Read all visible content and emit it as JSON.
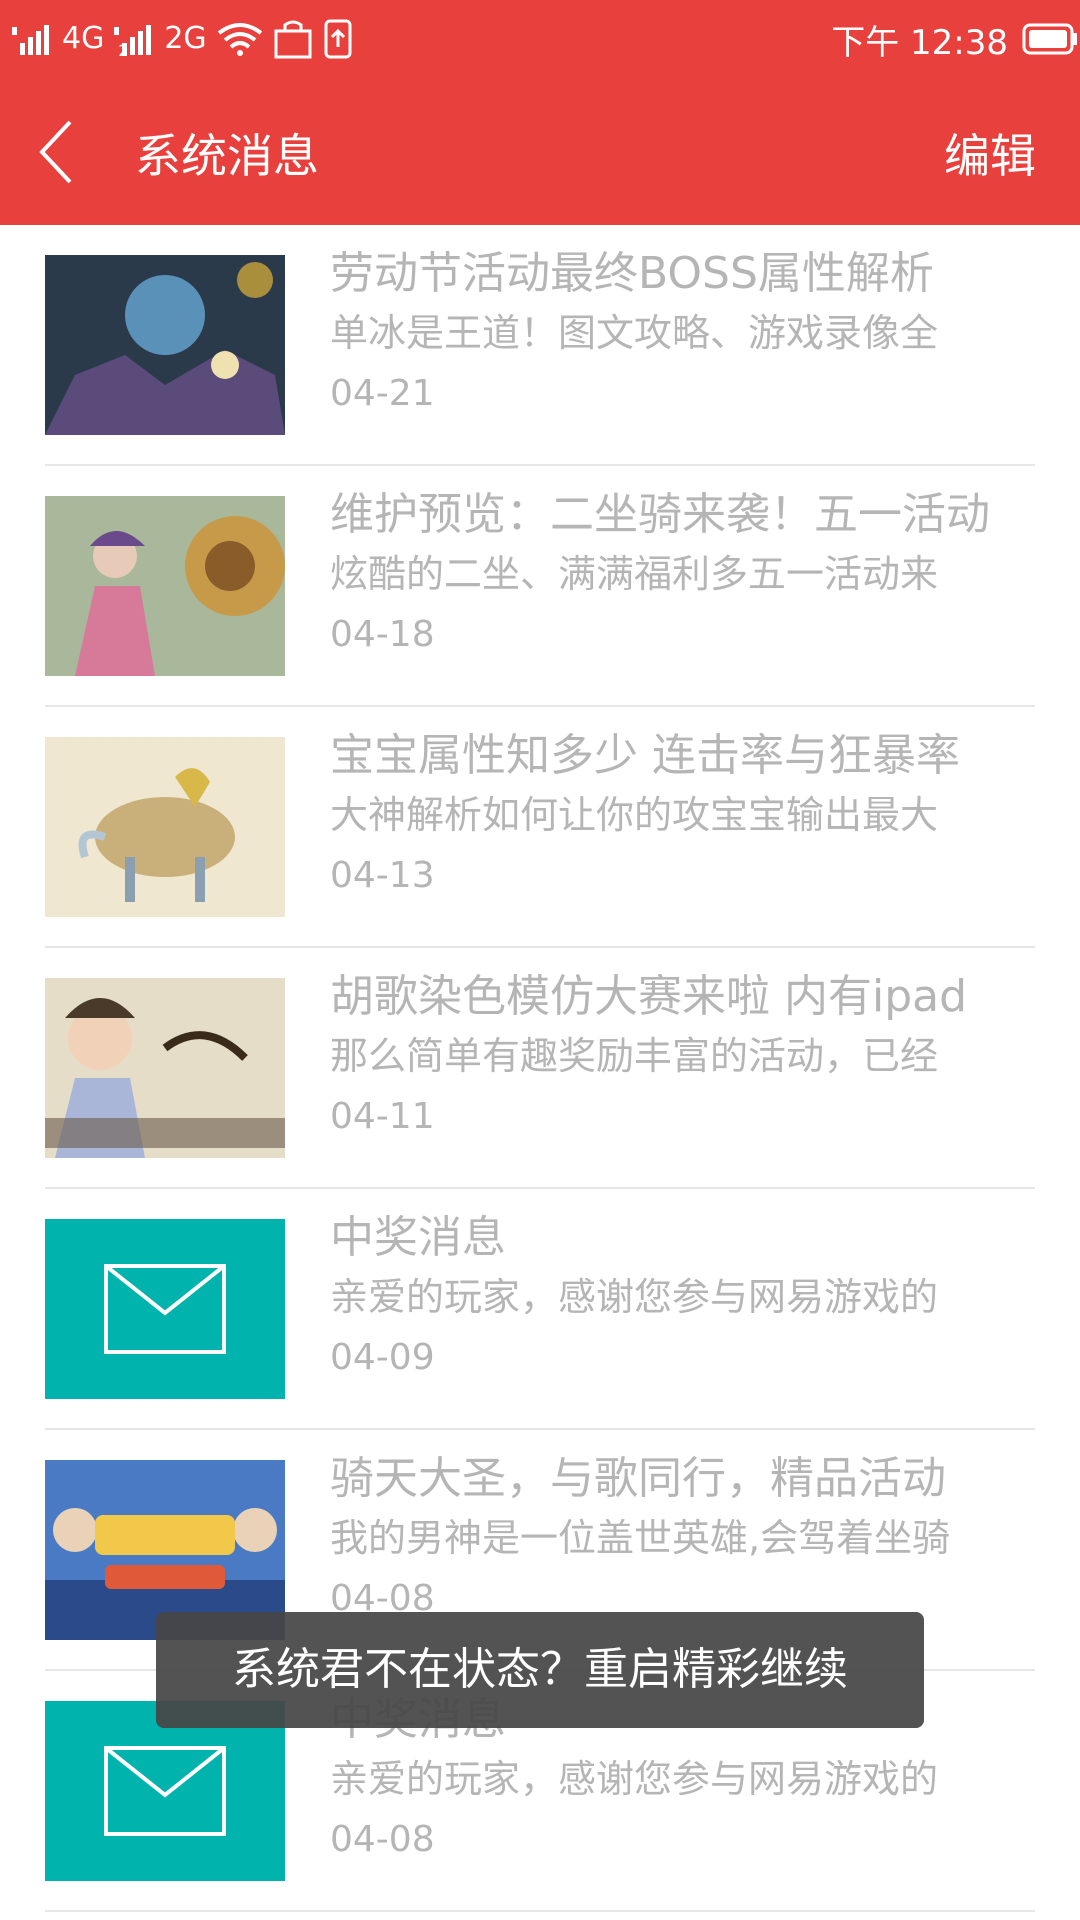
{
  "status_bar": {
    "left_network_1": "4G",
    "left_network_2": "2G",
    "sim_2_marker": "2",
    "time": "下午 12:38",
    "icons": [
      "signal-icon",
      "signal-icon",
      "wifi-icon",
      "shopping-bag-icon",
      "phone-upload-icon",
      "battery-icon"
    ]
  },
  "header": {
    "title": "系统消息",
    "edit_label": "编辑",
    "background_color": "#e8403d"
  },
  "messages": [
    {
      "title": "劳动节活动最终BOSS属性解析",
      "summary": "单冰是王道！图文攻略、游戏录像全",
      "date": "04-21",
      "thumb": "game-art-1"
    },
    {
      "title": "维护预览：二坐骑来袭！五一活动",
      "summary": "炫酷的二坐、满满福利多五一活动来",
      "date": "04-18",
      "thumb": "game-art-2"
    },
    {
      "title": "宝宝属性知多少 连击率与狂暴率",
      "summary": "大神解析如何让你的攻宝宝输出最大",
      "date": "04-13",
      "thumb": "game-art-3"
    },
    {
      "title": "胡歌染色模仿大赛来啦 内有ipad",
      "summary": "那么简单有趣奖励丰富的活动，已经",
      "date": "04-11",
      "thumb": "game-art-4"
    },
    {
      "title": "中奖消息",
      "summary": "亲爱的玩家，感谢您参与网易游戏的",
      "date": "04-09",
      "thumb": "mail-icon"
    },
    {
      "title": "骑天大圣，与歌同行，精品活动",
      "summary": "我的男神是一位盖世英雄,会驾着坐骑",
      "date": "04-08",
      "thumb": "game-art-5"
    },
    {
      "title": "中奖消息",
      "summary": "亲爱的玩家，感谢您参与网易游戏的",
      "date": "04-08",
      "thumb": "mail-icon"
    }
  ],
  "toast": {
    "text": "系统君不在状态？重启精彩继续"
  },
  "colors": {
    "accent": "#e8403d",
    "mail_tile": "#00b3ad",
    "secondary_text": "#b5b5b5"
  }
}
